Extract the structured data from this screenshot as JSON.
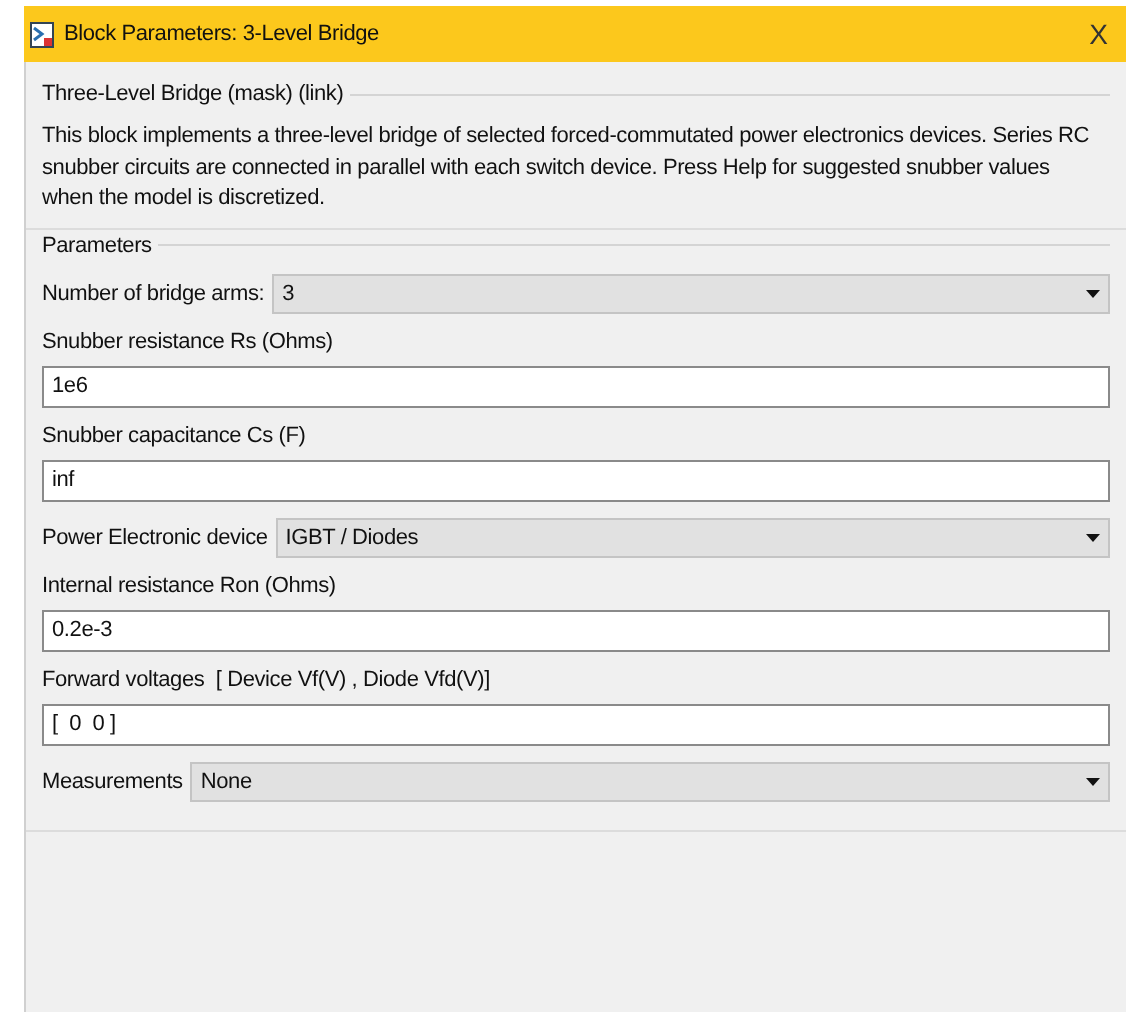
{
  "window": {
    "title": "Block Parameters: 3-Level Bridge",
    "close_button": "X"
  },
  "description_group": {
    "title": "Three-Level Bridge (mask) (link)",
    "text": "This block implements a three-level bridge of selected forced-commutated power electronics devices.  Series RC snubber circuits are connected in parallel with each switch device.  Press Help for suggested snubber values when the model is discretized."
  },
  "parameters_group": {
    "title": "Parameters",
    "fields": [
      {
        "kind": "dropdown",
        "label": "Number of bridge arms:",
        "value": "3"
      },
      {
        "kind": "text",
        "label": "Snubber resistance Rs (Ohms)",
        "value": "1e6"
      },
      {
        "kind": "text",
        "label": "Snubber capacitance Cs (F)",
        "value": "inf"
      },
      {
        "kind": "dropdown",
        "label": "Power Electronic device",
        "value": "IGBT / Diodes"
      },
      {
        "kind": "text",
        "label": "Internal resistance Ron (Ohms)",
        "value": "0.2e-3"
      },
      {
        "kind": "text",
        "label": "Forward voltages  [ Device Vf(V) , Diode Vfd(V)]",
        "value": "[  0  0 ]"
      },
      {
        "kind": "dropdown",
        "label": "Measurements",
        "value": "None"
      }
    ]
  }
}
